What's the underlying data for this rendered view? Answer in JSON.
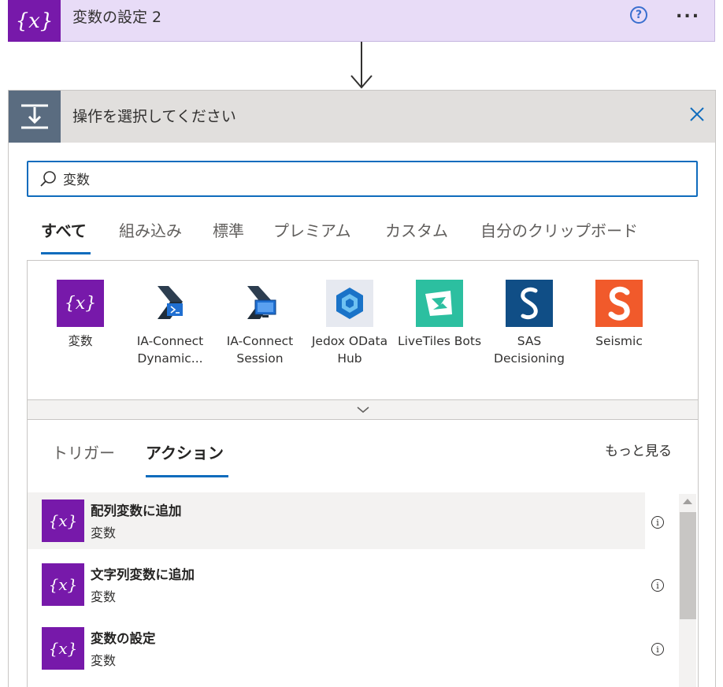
{
  "top_card": {
    "icon": "{x}",
    "title": "変数の設定 2",
    "help_icon": "?",
    "more_icon": "..."
  },
  "op_card": {
    "title": "操作を選択してください"
  },
  "search": {
    "value": "変数"
  },
  "category_tabs": [
    {
      "label": "すべて",
      "active": true
    },
    {
      "label": "組み込み"
    },
    {
      "label": "標準"
    },
    {
      "label": "プレミアム"
    },
    {
      "label": "カスタム"
    },
    {
      "label": "自分のクリップボード"
    }
  ],
  "connectors": [
    {
      "label": "変数",
      "icon": "variable-icon",
      "color": "#7719aa"
    },
    {
      "label": "IA-Connect Dynamic...",
      "icon": "ia-connect-dynamic-icon"
    },
    {
      "label": "IA-Connect Session",
      "icon": "ia-connect-session-icon"
    },
    {
      "label": "Jedox OData Hub",
      "icon": "jedox-icon",
      "color": "#e6e9f0"
    },
    {
      "label": "LiveTiles Bots",
      "icon": "livetiles-icon",
      "color": "#2cbfa0"
    },
    {
      "label": "SAS Decisioning",
      "icon": "sas-icon",
      "color": "#104e86"
    },
    {
      "label": "Seismic",
      "icon": "seismic-icon",
      "color": "#f15a2b"
    }
  ],
  "sub_tabs": [
    {
      "label": "トリガー"
    },
    {
      "label": "アクション",
      "active": true
    }
  ],
  "see_more": "もっと見る",
  "actions": [
    {
      "title": "配列変数に追加",
      "subtitle": "変数",
      "icon": "{x}"
    },
    {
      "title": "文字列変数に追加",
      "subtitle": "変数",
      "icon": "{x}"
    },
    {
      "title": "変数の設定",
      "subtitle": "変数",
      "icon": "{x}"
    }
  ],
  "info_icon": "i",
  "colors": {
    "variable_purple": "#7719aa",
    "accent_blue": "#0f6cbd",
    "top_card_bg": "#e8dcf7",
    "op_header_bg": "#e1dfdd"
  }
}
